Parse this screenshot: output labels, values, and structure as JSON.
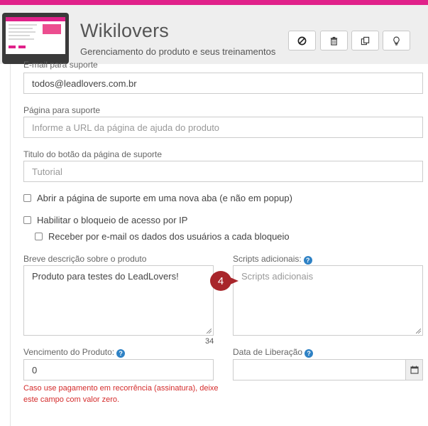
{
  "app": {
    "title": "Wikilovers",
    "subtitle": "Gerenciamento do produto e seus treinamentos",
    "accent_color": "#e0218a"
  },
  "header_buttons": [
    {
      "icon": "block-icon"
    },
    {
      "icon": "trash-icon"
    },
    {
      "icon": "copy-icon"
    },
    {
      "icon": "lightbulb-icon"
    }
  ],
  "form": {
    "support_email": {
      "label": "E-mail para suporte",
      "value": "todos@leadlovers.com.br"
    },
    "support_page": {
      "label": "Página para suporte",
      "placeholder": "Informe a URL da página de ajuda do produto"
    },
    "support_button_title": {
      "label": "Titulo do botão da página de suporte",
      "placeholder": "Tutorial"
    },
    "open_new_tab": {
      "label": "Abrir a página de suporte em uma nova aba (e não em popup)"
    },
    "ip_block": {
      "label": "Habilitar o bloqueio de acesso por IP"
    },
    "email_on_block": {
      "label": "Receber por e-mail os dados dos usuários a cada bloqueio"
    },
    "description": {
      "label": "Breve descrição sobre o produto",
      "value": "Produto para testes do LeadLovers!",
      "char_count": "34"
    },
    "scripts": {
      "label": "Scripts adicionais:",
      "placeholder": "Scripts adicionais"
    },
    "expiration": {
      "label": "Vencimento do Produto:",
      "value": "0",
      "error_line1": "Caso use pagamento em recorrência (assinatura), deixe",
      "error_line2": "este campo com valor zero."
    },
    "release_date": {
      "label": "Data de Liberação",
      "value": ""
    }
  },
  "step_badge": {
    "number": "4",
    "color": "#a8262b"
  }
}
